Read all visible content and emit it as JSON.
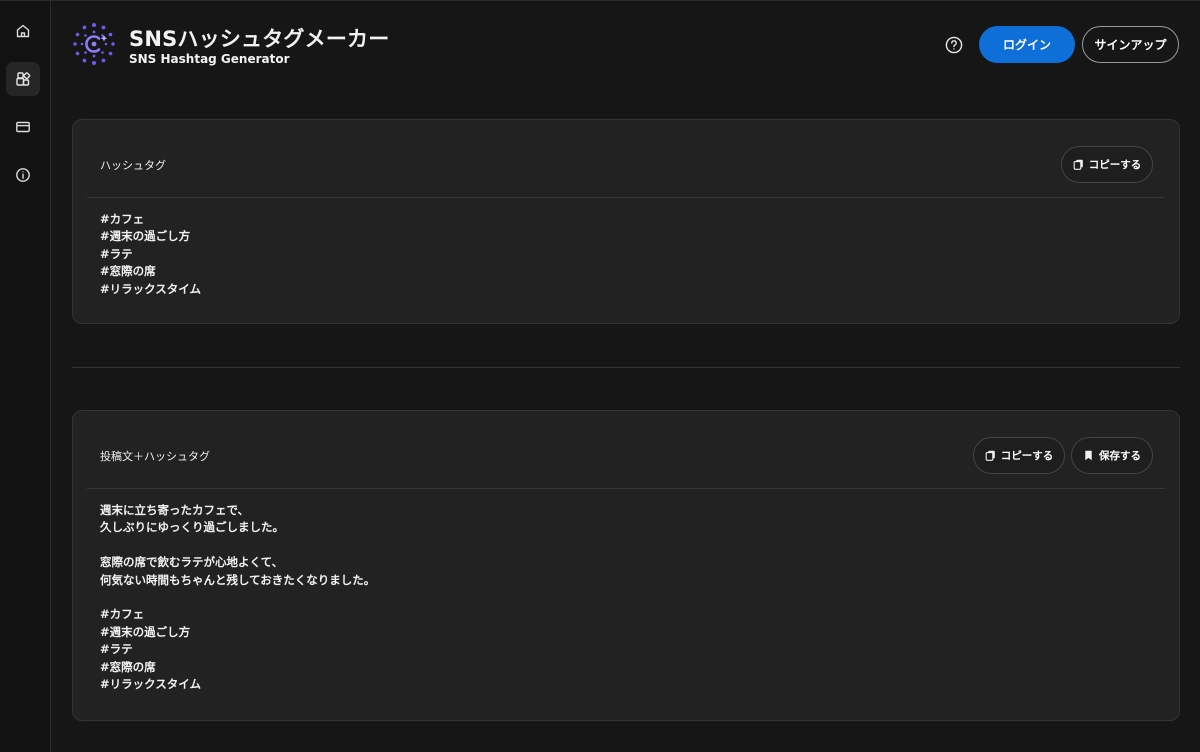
{
  "app": {
    "title": "SNSハッシュタグメーカー",
    "subtitle": "SNS Hashtag Generator",
    "accent_color": "#0f6fd8",
    "logo_color": "#6b5cf0"
  },
  "sidebar": {
    "items": [
      {
        "icon": "home-icon",
        "active": false
      },
      {
        "icon": "apps-icon",
        "active": true
      },
      {
        "icon": "card-icon",
        "active": false
      },
      {
        "icon": "info-icon",
        "active": false
      }
    ]
  },
  "header": {
    "help_icon": "help-icon",
    "login_label": "ログイン",
    "signup_label": "サインアップ"
  },
  "hashtag_card": {
    "label": "ハッシュタグ",
    "copy_label": "コピーする",
    "content": "#カフェ\n#週末の過ごし方\n#ラテ\n#窓際の席\n#リラックスタイム"
  },
  "post_card": {
    "label": "投稿文＋ハッシュタグ",
    "copy_label": "コピーする",
    "save_label": "保存する",
    "content": "週末に立ち寄ったカフェで、\n久しぶりにゆっくり過ごしました。\n\n窓際の席で飲むラテが心地よくて、\n何気ない時間もちゃんと残しておきたくなりました。\n\n#カフェ\n#週末の過ごし方\n#ラテ\n#窓際の席\n#リラックスタイム"
  }
}
